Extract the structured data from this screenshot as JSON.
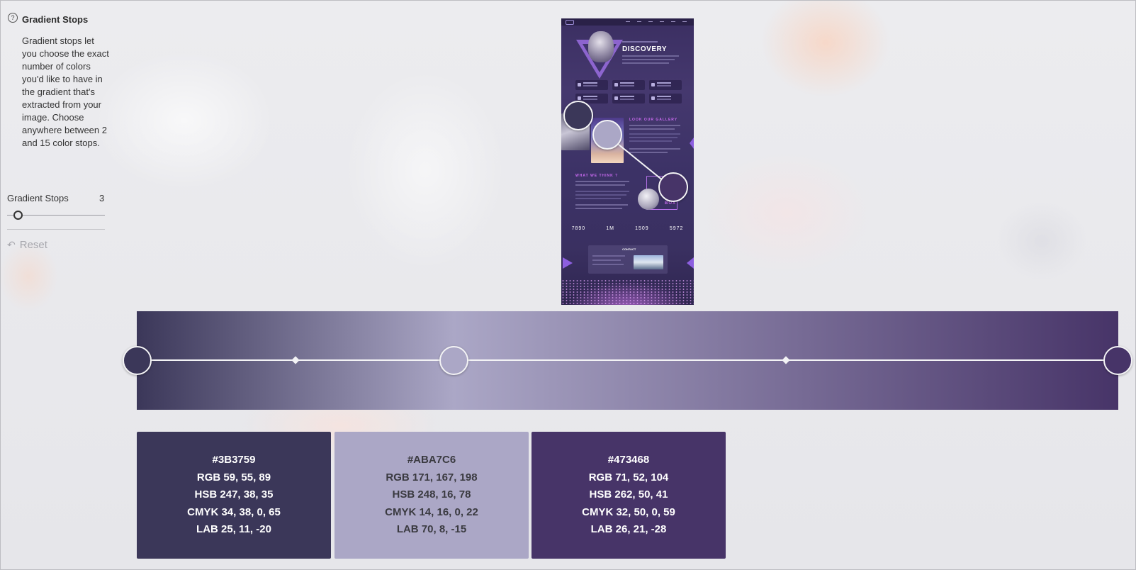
{
  "sidebar": {
    "help_icon": "question-circle-icon",
    "title": "Gradient Stops",
    "description": "Gradient stops let you choose the exact number of colors you'd like to have in the gradient that's extracted from your image. Choose anywhere between 2 and 15 color stops.",
    "stops_label": "Gradient Stops",
    "stops_value": "3",
    "slider": {
      "min": 2,
      "max": 15,
      "value": 3
    },
    "reset_label": "Reset",
    "reset_icon": "undo-arrow-icon"
  },
  "preview": {
    "title": "DISCOVERY",
    "gallery_heading": "LOOK OUR GALLERY",
    "think_heading": "WHAT WE THINK ?",
    "box_label": "BOX",
    "stats": [
      "7890",
      "1M",
      "1509",
      "5972"
    ],
    "panel_label": "CONTACT"
  },
  "gradient": {
    "stops": [
      {
        "position": 0.0,
        "color": "#3B3759"
      },
      {
        "position": 0.323,
        "color": "#ABA7C6"
      },
      {
        "position": 1.0,
        "color": "#473468"
      }
    ],
    "midpoints": [
      0.161,
      0.661
    ]
  },
  "swatches": [
    {
      "hex": "#3B3759",
      "rgb": "RGB 59, 55, 89",
      "hsb": "HSB 247, 38, 35",
      "cmyk": "CMYK 34, 38, 0, 65",
      "lab": "LAB 25, 11, -20",
      "bg": "#3b3759",
      "fg": "#ffffff"
    },
    {
      "hex": "#ABA7C6",
      "rgb": "RGB 171, 167, 198",
      "hsb": "HSB 248, 16, 78",
      "cmyk": "CMYK 14, 16, 0, 22",
      "lab": "LAB 70, 8, -15",
      "bg": "#aba7c6",
      "fg": "#3a3a40"
    },
    {
      "hex": "#473468",
      "rgb": "RGB 71, 52, 104",
      "hsb": "HSB 262, 50, 41",
      "cmyk": "CMYK 32, 50, 0, 59",
      "lab": "LAB 26, 21, -28",
      "bg": "#473468",
      "fg": "#ffffff"
    }
  ]
}
